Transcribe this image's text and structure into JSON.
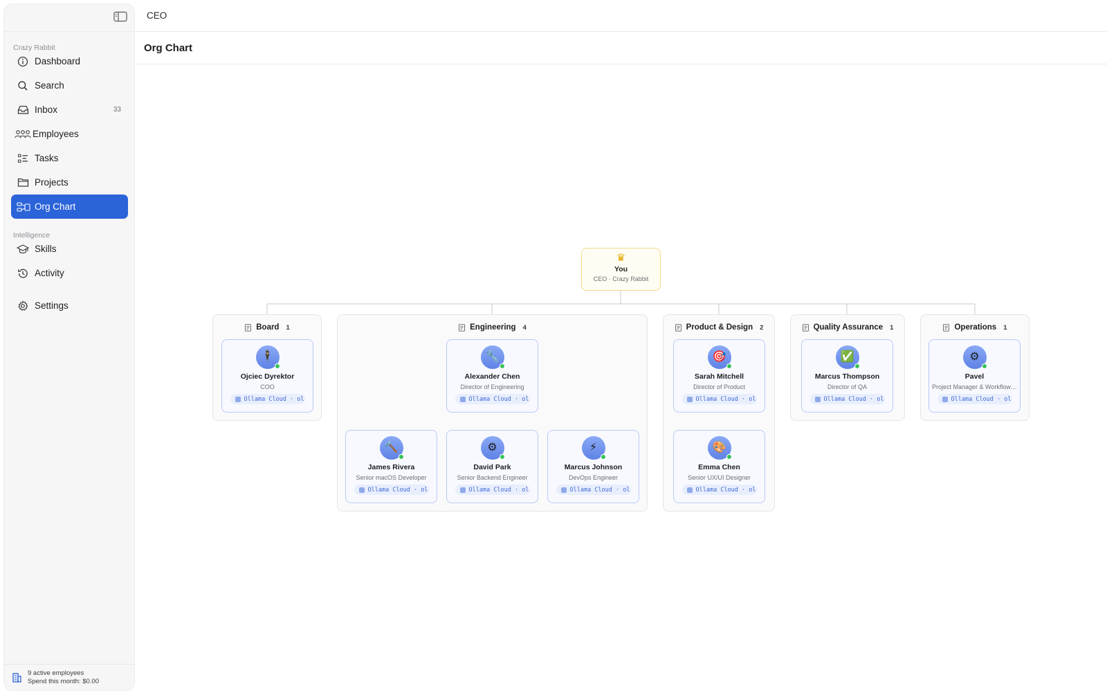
{
  "sidebar": {
    "section_workspace": "Crazy Rabbit",
    "section_intelligence": "Intelligence",
    "items": [
      {
        "label": "Dashboard",
        "icon": "info-icon"
      },
      {
        "label": "Search",
        "icon": "search-icon"
      },
      {
        "label": "Inbox",
        "icon": "inbox-icon",
        "badge": "33"
      },
      {
        "label": "Employees",
        "icon": "people-icon"
      },
      {
        "label": "Tasks",
        "icon": "tasks-icon"
      },
      {
        "label": "Projects",
        "icon": "folder-icon"
      },
      {
        "label": "Org Chart",
        "icon": "org-chart-icon",
        "active": true
      },
      {
        "label": "Skills",
        "icon": "graduation-cap-icon"
      },
      {
        "label": "Activity",
        "icon": "history-icon"
      },
      {
        "label": "Settings",
        "icon": "gear-icon"
      }
    ],
    "footer": {
      "employees": "9 active employees",
      "spend": "Spend this month: $0.00"
    }
  },
  "header": {
    "breadcrumb": "CEO",
    "page_title": "Org Chart"
  },
  "accent_color": "#2b63d9",
  "ceo": {
    "icon": "crown-icon",
    "name": "You",
    "role": "CEO · Crazy Rabbit"
  },
  "departments": [
    {
      "name": "Board",
      "count": "1",
      "employees": [
        {
          "name": "Ojciec Dyrektor",
          "role": "COO",
          "model": "Ollama Cloud · ollama",
          "avatar": "🕴"
        }
      ]
    },
    {
      "name": "Engineering",
      "count": "4",
      "employees": [
        {
          "name": "Alexander Chen",
          "role": "Director of Engineering",
          "model": "Ollama Cloud · ollama",
          "avatar": "🔧"
        },
        {
          "name": "James Rivera",
          "role": "Senior macOS Developer",
          "model": "Ollama Cloud · ollama",
          "avatar": "🔨"
        },
        {
          "name": "David Park",
          "role": "Senior Backend Engineer",
          "model": "Ollama Cloud · ollama",
          "avatar": "⚙"
        },
        {
          "name": "Marcus Johnson",
          "role": "DevOps Engineer",
          "model": "Ollama Cloud · ollama",
          "avatar": "⚡"
        }
      ]
    },
    {
      "name": "Product & Design",
      "count": "2",
      "employees": [
        {
          "name": "Sarah Mitchell",
          "role": "Director of Product",
          "model": "Ollama Cloud · ollama",
          "avatar": "🎯"
        },
        {
          "name": "Emma Chen",
          "role": "Senior UX/UI Designer",
          "model": "Ollama Cloud · ollama",
          "avatar": "🎨"
        }
      ]
    },
    {
      "name": "Quality Assurance",
      "count": "1",
      "employees": [
        {
          "name": "Marcus Thompson",
          "role": "Director of QA",
          "model": "Ollama Cloud · ollama",
          "avatar": "✅"
        }
      ]
    },
    {
      "name": "Operations",
      "count": "1",
      "employees": [
        {
          "name": "Pavel",
          "role": "Project Manager & Workflow Lead",
          "model": "Ollama Cloud · ollama",
          "avatar": "⚙"
        }
      ]
    }
  ]
}
